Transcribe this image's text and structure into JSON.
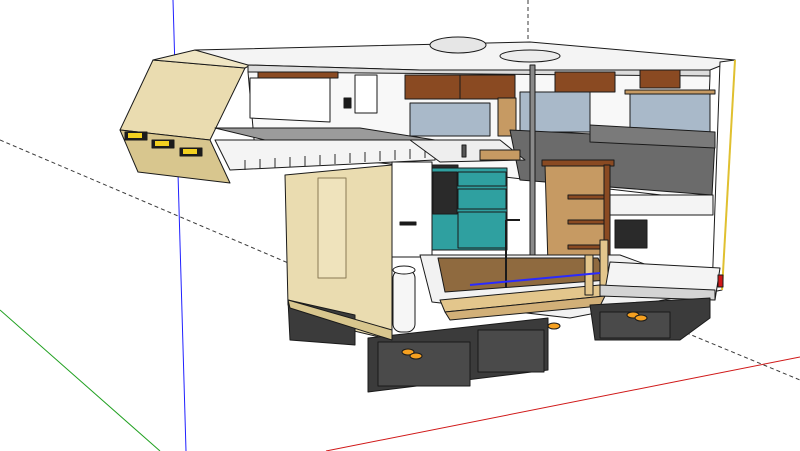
{
  "viewport": {
    "background": "#ffffff",
    "axis_colors": {
      "blue": "#2020ff",
      "red": "#d01818",
      "green": "#20a020",
      "dashed": "#3a3a3a"
    }
  },
  "model": {
    "subject": "truck-camper-cutaway-3d-model",
    "palette": {
      "body_beige": "#eadcb0",
      "body_beige_dark": "#d8c68e",
      "roof_white": "#f4f4f4",
      "dark_storage": "#3b3b3b",
      "storage_face": "#4a4a4a",
      "wood_cabinet": "#8a4a22",
      "wood_light": "#c69a63",
      "teal_cabinet": "#2fa0a0",
      "window_glass": "#a9b9c9",
      "seat_gray": "#6b6b6b",
      "floor_brown": "#8f6a3f",
      "pipe_tan": "#e3c68c",
      "amber_light": "#f5a020",
      "yellow_light": "#f2d020"
    }
  }
}
